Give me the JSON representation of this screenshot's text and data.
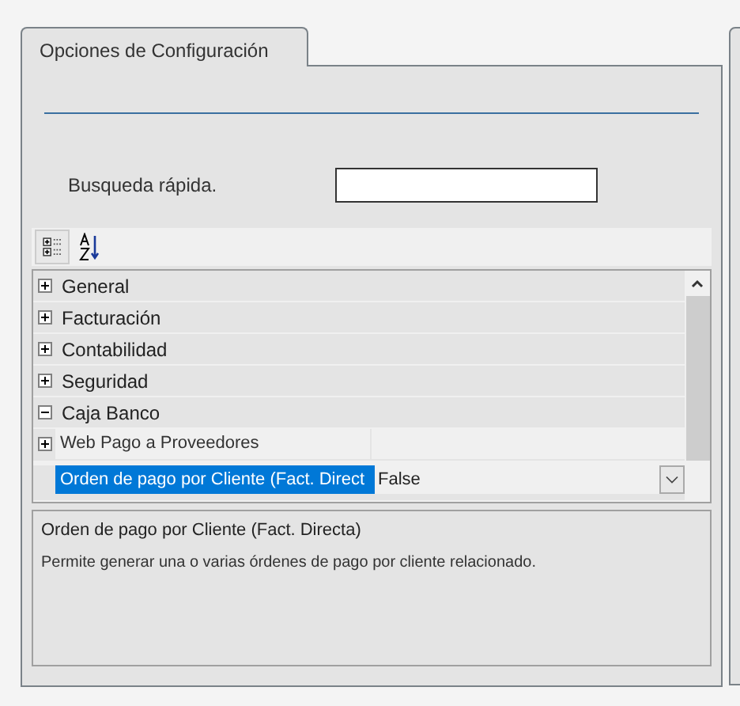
{
  "tab": {
    "label": "Opciones de Configuración",
    "selected": true
  },
  "search": {
    "label": "Busqueda rápida."
  },
  "grid": {
    "categories": [
      {
        "label": "General",
        "expanded": false
      },
      {
        "label": "Facturación",
        "expanded": false
      },
      {
        "label": "Contabilidad",
        "expanded": false
      },
      {
        "label": "Seguridad",
        "expanded": false
      },
      {
        "label": "Caja Banco",
        "expanded": true,
        "children": [
          {
            "kind": "group",
            "label": "Web Pago a Proveedores",
            "expanded": false
          },
          {
            "kind": "property",
            "label": "Orden de pago por Cliente (Fact. Direct",
            "value": "False",
            "selected": true
          }
        ]
      }
    ]
  },
  "description": {
    "title": "Orden de pago por Cliente (Fact. Directa)",
    "text": "Permite generar una o varias órdenes de pago por cliente relacionado."
  }
}
